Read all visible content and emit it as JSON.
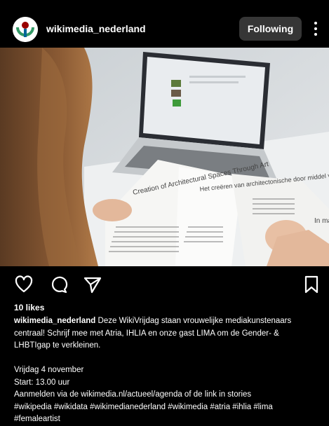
{
  "post": {
    "username": "wikimedia_nederland",
    "follow_label": "Following",
    "likes": "10 likes",
    "caption_user": "wikimedia_nederland",
    "caption_lines": [
      "Deze WikiVrijdag staan vrouwelijke mediakunstenaars",
      "centraal! Schrijf mee met Atria, IHLIA en onze gast LIMA om de Gender- &",
      "LHBTIgap te verkleinen.",
      "",
      "Vrijdag 4 november",
      "Start: 13.00 uur",
      "Aanmelden via de wikimedia.nl/actueel/agenda of de link in stories",
      "#wikipedia #wikidata #wikimedianederland #wikimedia #atria #ihlia #lima",
      "#femaleartist"
    ],
    "photo_texts": {
      "left_title": "Creation of Architectural Spaces Through Art",
      "right_title": "Het creëren van architectonische door middel van kunst",
      "far_right": "In ma"
    }
  },
  "icons": [
    "wikimedia-logo-icon",
    "more-options-icon",
    "heart-icon",
    "comment-icon",
    "share-icon",
    "bookmark-icon"
  ],
  "colors": {
    "background": "#000000",
    "button": "#363636",
    "text": "#ffffff"
  }
}
